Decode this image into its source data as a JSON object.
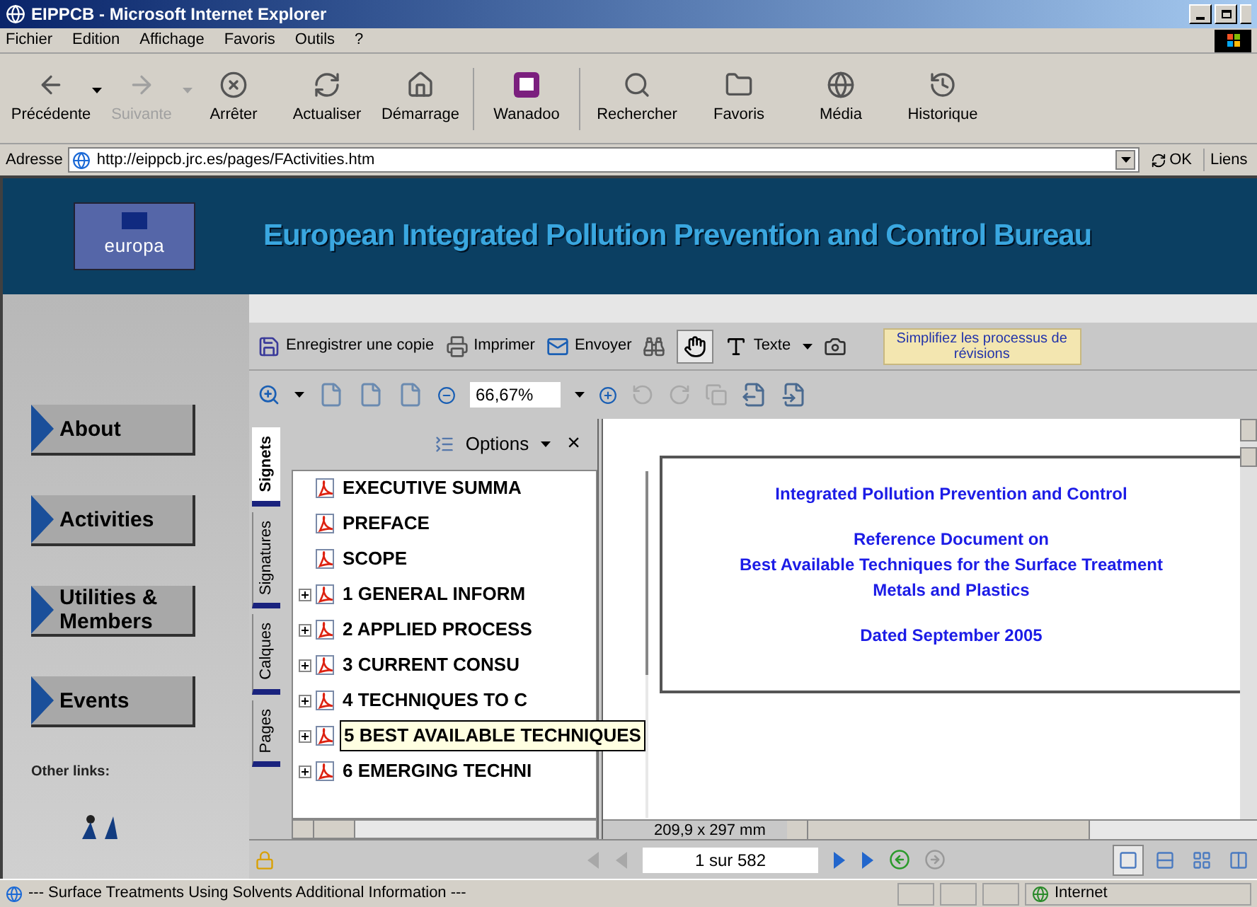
{
  "window": {
    "title": "EIPPCB - Microsoft Internet Explorer"
  },
  "menu": [
    "Fichier",
    "Edition",
    "Affichage",
    "Favoris",
    "Outils",
    "?"
  ],
  "toolbar": [
    {
      "label": "Précédente",
      "disabled": false,
      "dropdown": true
    },
    {
      "label": "Suivante",
      "disabled": true,
      "dropdown": true
    },
    {
      "label": "Arrêter",
      "disabled": false,
      "dropdown": false
    },
    {
      "label": "Actualiser",
      "disabled": false,
      "dropdown": false
    },
    {
      "label": "Démarrage",
      "disabled": false,
      "dropdown": false
    },
    {
      "label": "Wanadoo",
      "disabled": false,
      "dropdown": false
    },
    {
      "label": "Rechercher",
      "disabled": false,
      "dropdown": false
    },
    {
      "label": "Favoris",
      "disabled": false,
      "dropdown": false
    },
    {
      "label": "Média",
      "disabled": false,
      "dropdown": false
    },
    {
      "label": "Historique",
      "disabled": false,
      "dropdown": false
    }
  ],
  "address_bar": {
    "label": "Adresse",
    "value": "http://eippcb.jrc.es/pages/FActivities.htm",
    "go": "OK",
    "links": "Liens"
  },
  "site": {
    "logo": "europa",
    "title": "European Integrated Pollution Prevention and Control Bureau",
    "nav": [
      "About",
      "Activities",
      "Utilities & Members",
      "Events"
    ],
    "other_links": "Other links:"
  },
  "pdf_toolbar": {
    "save": "Enregistrer une copie",
    "print": "Imprimer",
    "send": "Envoyer",
    "hand_selected": true,
    "text_tool": "Texte",
    "promo": "Simplifiez les processus de révisions",
    "zoom": "66,67%"
  },
  "side_tabs": [
    {
      "label": "Signets",
      "selected": true
    },
    {
      "label": "Signatures",
      "selected": false
    },
    {
      "label": "Calques",
      "selected": false
    },
    {
      "label": "Pages",
      "selected": false
    }
  ],
  "bookmarks": {
    "options": "Options",
    "close": "×",
    "items": [
      {
        "label": "EXECUTIVE SUMMA",
        "expandable": false,
        "tooltip": false
      },
      {
        "label": "PREFACE",
        "expandable": false,
        "tooltip": false
      },
      {
        "label": "SCOPE",
        "expandable": false,
        "tooltip": false
      },
      {
        "label": "1 GENERAL INFORM",
        "expandable": true,
        "tooltip": false
      },
      {
        "label": "2 APPLIED PROCESS",
        "expandable": true,
        "tooltip": false
      },
      {
        "label": "3 CURRENT CONSU",
        "expandable": true,
        "tooltip": false
      },
      {
        "label": "4 TECHNIQUES TO C",
        "expandable": true,
        "tooltip": false
      },
      {
        "label": "5 BEST AVAILABLE TECHNIQUES",
        "expandable": true,
        "tooltip": true
      },
      {
        "label": "6 EMERGING TECHNI",
        "expandable": true,
        "tooltip": false
      }
    ]
  },
  "document": {
    "paragraphs": [
      [
        "Integrated Pollution Prevention and Control"
      ],
      [
        "Reference Document on",
        "Best Available Techniques for the Surface Treatment",
        "Metals and Plastics"
      ],
      [
        "Dated September 2005"
      ]
    ],
    "page_size": "209,9 x 297 mm"
  },
  "page_nav": {
    "page": "1 sur 582",
    "views": [
      {
        "selected": true
      },
      {
        "selected": false
      },
      {
        "selected": false
      },
      {
        "selected": false
      }
    ]
  },
  "status_bar": {
    "text": "--- Surface Treatments Using Solvents Additional Information ---",
    "zone": "Internet"
  }
}
